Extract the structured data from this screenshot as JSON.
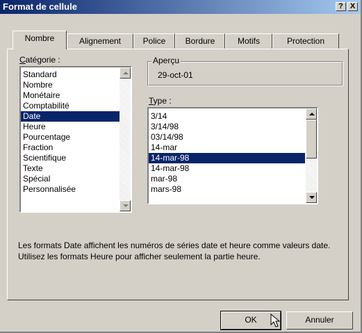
{
  "window": {
    "title": "Format de cellule",
    "help_button": "?",
    "close_button": "X"
  },
  "tabs": [
    {
      "label": "Nombre",
      "active": true
    },
    {
      "label": "Alignement",
      "active": false
    },
    {
      "label": "Police",
      "active": false
    },
    {
      "label": "Bordure",
      "active": false
    },
    {
      "label": "Motifs",
      "active": false
    },
    {
      "label": "Protection",
      "active": false
    }
  ],
  "category": {
    "label_underline": "C",
    "label_rest": "atégorie :",
    "items": [
      "Standard",
      "Nombre",
      "Monétaire",
      "Comptabilité",
      "Date",
      "Heure",
      "Pourcentage",
      "Fraction",
      "Scientifique",
      "Texte",
      "Spécial",
      "Personnalisée"
    ],
    "selected": "Date"
  },
  "preview": {
    "title": "Aperçu",
    "value": "29-oct-01"
  },
  "type": {
    "label_underline": "T",
    "label_rest": "ype :",
    "items": [
      "3/14",
      "3/14/98",
      "03/14/98",
      "14-mar",
      "14-mar-98",
      "14-mar-98",
      "mar-98",
      "mars-98"
    ],
    "selected_index": 4
  },
  "description": "Les formats Date affichent les numéros de séries date et heure comme valeurs date. Utilisez les formats Heure pour afficher seulement la partie heure.",
  "buttons": {
    "ok": "OK",
    "cancel": "Annuler"
  },
  "colors": {
    "selection": "#0a246a",
    "face": "#d4d0c8",
    "title_start": "#0a246a",
    "title_end": "#a6caf0"
  }
}
